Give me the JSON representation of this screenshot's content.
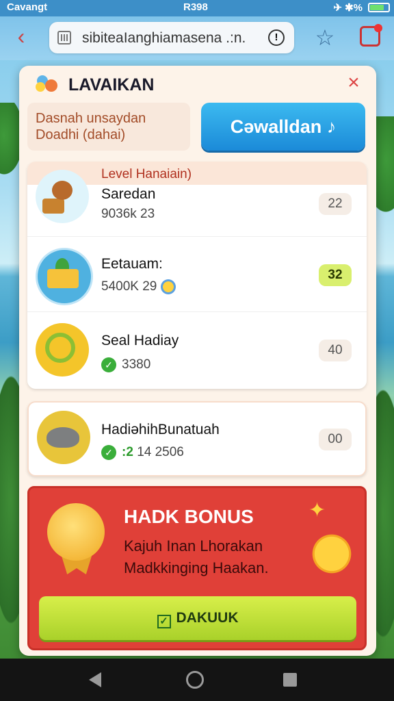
{
  "status_bar": {
    "carrier": "Cavangt",
    "time": "R398",
    "right_text": "✈ ✱%"
  },
  "browser": {
    "url": "sibiteaIanghiamasena .:n."
  },
  "modal": {
    "title": "LAVAIKAN",
    "description_line1": "Dasnah unsaydan",
    "description_line2": "Doadhi (dahai)",
    "primary_button": "Cəwalldan ♪",
    "level_label": "Level Hanaiain)",
    "items": [
      {
        "name": "Saredan",
        "meta": "9036k 23",
        "badge": "22"
      },
      {
        "name": "Eetauam:",
        "meta": "5400K 29",
        "badge": "32"
      },
      {
        "name": "Seal Hadiay",
        "meta": "3380",
        "badge": "40"
      },
      {
        "name": "HadiəhihBunatuah",
        "meta_green": ":2",
        "meta": "14 2506",
        "badge": "00"
      }
    ]
  },
  "bonus": {
    "title": "HADK BONUS",
    "line1": "Kajuh Inan Lhorakan",
    "line2": "Madkkinging Haakan.",
    "button": "DAKUUK"
  }
}
